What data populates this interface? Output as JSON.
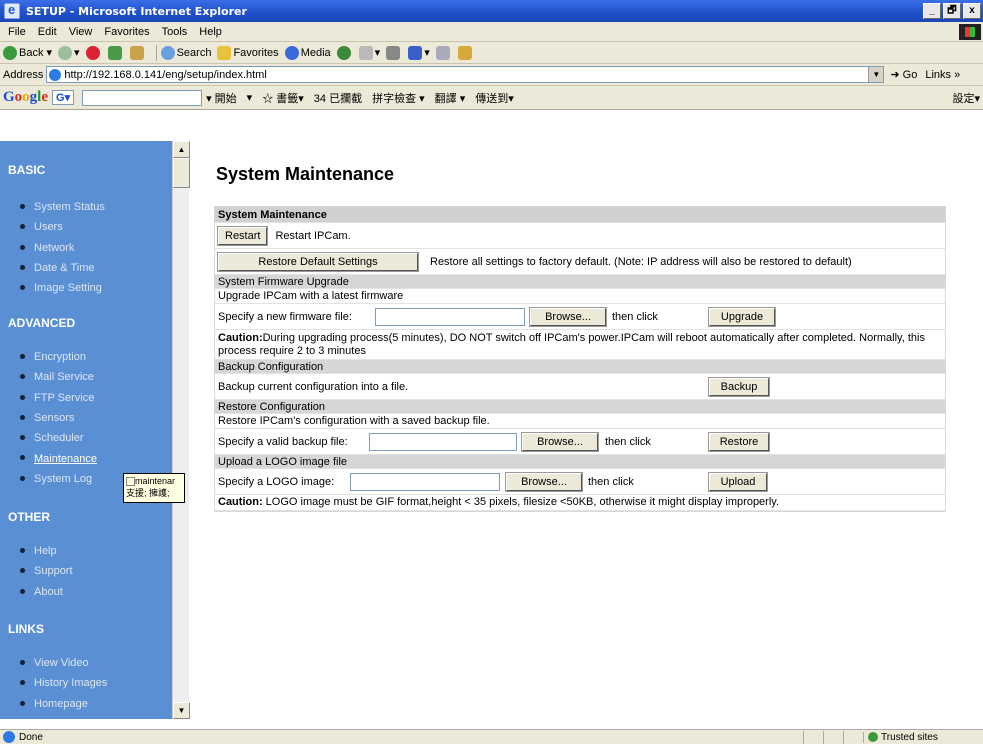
{
  "window": {
    "title": "SETUP - Microsoft Internet Explorer",
    "min_label": "_",
    "max_label": "🗗",
    "close_label": "x"
  },
  "menu": [
    "File",
    "Edit",
    "View",
    "Favorites",
    "Tools",
    "Help"
  ],
  "toolbar": {
    "back": "Back",
    "search": "Search",
    "favorites": "Favorites",
    "media": "Media"
  },
  "address": {
    "label": "Address",
    "url": "http://192.168.0.141/eng/setup/index.html",
    "go": "Go",
    "links": "Links »"
  },
  "googlebar": {
    "logo": [
      "G",
      "o",
      "o",
      "g",
      "l",
      "e"
    ],
    "menu_label": "G▾",
    "items": [
      "▾ 開始",
      "▾",
      "☆ 書籤▾",
      "34 已攔截",
      "拼字檢查 ▾",
      "翻譯 ▾",
      "傳送到▾"
    ],
    "settings": "設定▾"
  },
  "sidebar": {
    "sections": [
      {
        "title": "BASIC",
        "items": [
          "System Status",
          "Users",
          "Network",
          "Date & Time",
          "Image Setting"
        ]
      },
      {
        "title": "ADVANCED",
        "items": [
          "Encryption",
          "Mail Service",
          "FTP Service",
          "Sensors",
          "Scheduler",
          "Maintenance",
          "System Log"
        ]
      },
      {
        "title": "OTHER",
        "items": [
          "Help",
          "Support",
          "About"
        ]
      },
      {
        "title": "LINKS",
        "items": [
          "View Video",
          "History Images",
          "Homepage"
        ]
      }
    ],
    "active_item": "Maintenance",
    "tooltip_line1": "maintenar",
    "tooltip_line2": "支援; 擁護;"
  },
  "main": {
    "title": "System Maintenance",
    "section_head": "System Maintenance",
    "restart_button": "Restart",
    "restart_desc": "Restart IPCam.",
    "restore_default_button": "Restore Default Settings",
    "restore_default_desc": "Restore all settings to factory default. (Note: IP address will also be restored to default)",
    "firmware_head": "System Firmware Upgrade",
    "firmware_desc": "Upgrade IPCam with a latest firmware",
    "firmware_label": "Specify a new firmware file:",
    "browse_label": "Browse...",
    "then_click": "then click",
    "upgrade_button": "Upgrade",
    "caution_label": "Caution:",
    "caution_upgrade": "During upgrading process(5 minutes), DO NOT switch off IPCam's power.IPCam will reboot automatically after completed. Normally, this process require 2 to 3 minutes",
    "backup_head": "Backup Configuration",
    "backup_desc": "Backup current configuration into a file.",
    "backup_button": "Backup",
    "restore_head": "Restore Configuration",
    "restore_desc": "Restore IPCam's configuration with a saved backup file.",
    "restore_label": "Specify a valid backup file:",
    "restore_button": "Restore",
    "logo_head": "Upload a LOGO image file",
    "logo_label": "Specify a LOGO image:",
    "upload_button": "Upload",
    "caution_logo": "LOGO image must be GIF format,height < 35 pixels, filesize <50KB, otherwise it might display improperly."
  },
  "status": {
    "text": "Done",
    "zone": "Trusted sites"
  },
  "colors": {
    "sidebar_bg": "#5b8fd3",
    "titlebar": "#1e4fc8",
    "section_bg": "#d0d0d0"
  }
}
